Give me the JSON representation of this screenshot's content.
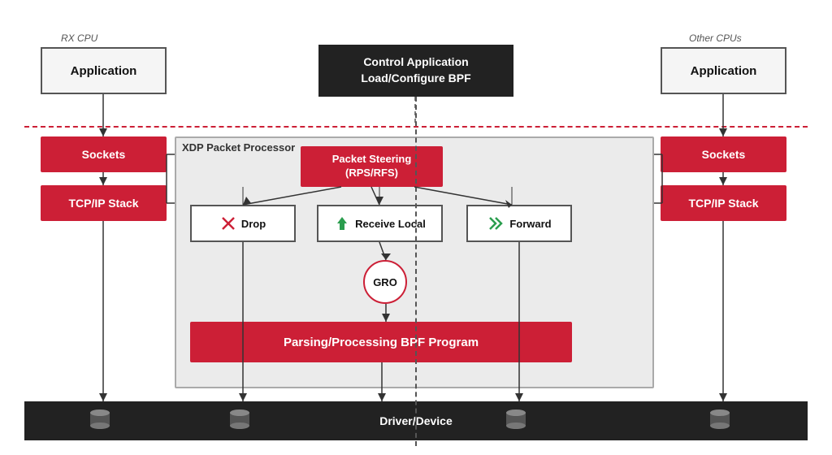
{
  "labels": {
    "rx_cpu": "RX CPU",
    "other_cpus": "Other CPUs",
    "driver_device": "Driver/Device"
  },
  "boxes": {
    "app_left": "Application",
    "app_right": "Application",
    "sockets_left": "Sockets",
    "tcp_left": "TCP/IP Stack",
    "sockets_right": "Sockets",
    "tcp_right": "TCP/IP Stack",
    "control": "Control Application\nLoad/Configure BPF",
    "xdp_label": "XDP Packet Processor",
    "packet_steering": "Packet Steering\n(RPS/RFS)",
    "drop": "Drop",
    "receive_local": "Receive Local",
    "forward": "Forward",
    "gro": "GRO",
    "parsing": "Parsing/Processing BPF Program"
  },
  "colors": {
    "red": "#cc1f36",
    "dark": "#222222",
    "light_bg": "#ebebeb",
    "border": "#888888"
  }
}
